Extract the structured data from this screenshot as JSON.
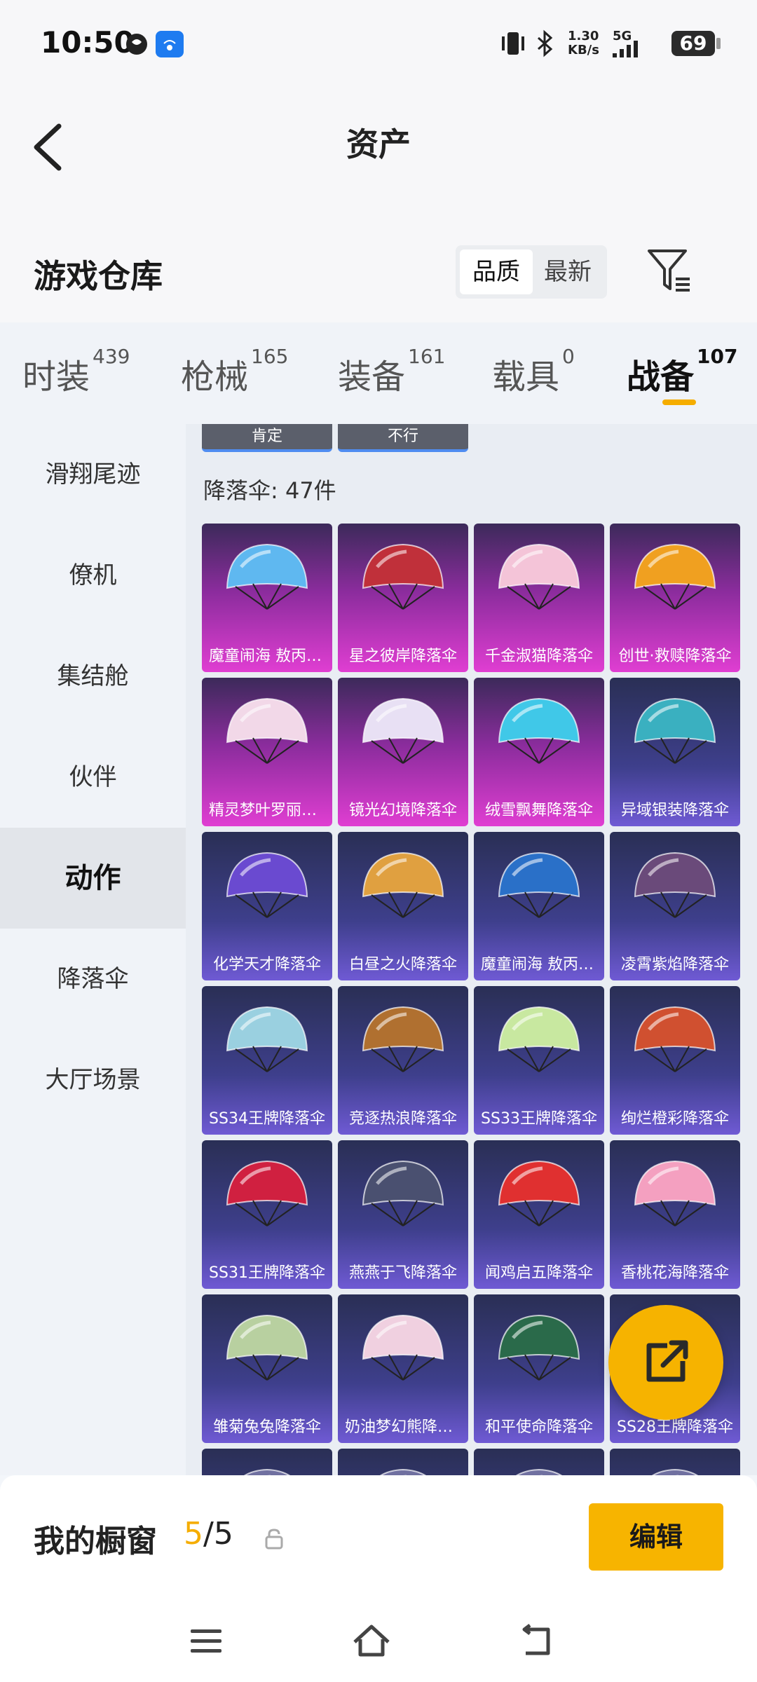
{
  "status_bar": {
    "time": "10:50",
    "net_speed_value": "1.30",
    "net_speed_unit": "KB/s",
    "network": "5G",
    "battery": "69"
  },
  "header": {
    "title": "资产"
  },
  "warehouse": {
    "title": "游戏仓库",
    "sort_options": [
      "品质",
      "最新"
    ],
    "active_sort": "品质"
  },
  "tabs": [
    {
      "label": "时装",
      "count": "439"
    },
    {
      "label": "枪械",
      "count": "165"
    },
    {
      "label": "装备",
      "count": "161"
    },
    {
      "label": "载具",
      "count": "0"
    },
    {
      "label": "战备",
      "count": "107"
    }
  ],
  "active_tab": "战备",
  "sidebar": {
    "items": [
      "滑翔尾迹",
      "僚机",
      "集结舱",
      "伙伴",
      "动作",
      "降落伞",
      "大厅场景"
    ],
    "active": "动作"
  },
  "chips": [
    "肯定",
    "不行"
  ],
  "section_count": "降落伞: 47件",
  "items": [
    {
      "name": "魔童闹海 敖丙降落伞",
      "rarity": "pink",
      "color": "#5fb8f0"
    },
    {
      "name": "星之彼岸降落伞",
      "rarity": "pink",
      "color": "#c0303a"
    },
    {
      "name": "千金淑猫降落伞",
      "rarity": "pink",
      "color": "#f4c4d8"
    },
    {
      "name": "创世·救赎降落伞",
      "rarity": "pink",
      "color": "#f0a020"
    },
    {
      "name": "精灵梦叶罗丽降落伞",
      "rarity": "pink",
      "color": "#f2d8e8"
    },
    {
      "name": "镜光幻境降落伞",
      "rarity": "pink",
      "color": "#e8e0f4"
    },
    {
      "name": "绒雪飘舞降落伞",
      "rarity": "pink",
      "color": "#40c8e8"
    },
    {
      "name": "异域银装降落伞",
      "rarity": "purple",
      "color": "#3ab0c0"
    },
    {
      "name": "化学天才降落伞",
      "rarity": "purple",
      "color": "#6a4ad0"
    },
    {
      "name": "白昼之火降落伞",
      "rarity": "purple",
      "color": "#e0a040"
    },
    {
      "name": "魔童闹海 敖丙降落伞",
      "rarity": "purple",
      "color": "#2a70c8"
    },
    {
      "name": "凌霄紫焰降落伞",
      "rarity": "purple",
      "color": "#6a4a7a"
    },
    {
      "name": "SS34王牌降落伞",
      "rarity": "purple",
      "color": "#9ad0e0"
    },
    {
      "name": "竞逐热浪降落伞",
      "rarity": "purple",
      "color": "#b07030"
    },
    {
      "name": "SS33王牌降落伞",
      "rarity": "purple",
      "color": "#c8e8a0"
    },
    {
      "name": "绚烂橙彩降落伞",
      "rarity": "purple",
      "color": "#d05030"
    },
    {
      "name": "SS31王牌降落伞",
      "rarity": "purple",
      "color": "#d02040"
    },
    {
      "name": "燕燕于飞降落伞",
      "rarity": "purple",
      "color": "#4a5070"
    },
    {
      "name": "闻鸡启五降落伞",
      "rarity": "purple",
      "color": "#e03030"
    },
    {
      "name": "香桃花海降落伞",
      "rarity": "purple",
      "color": "#f4a0c0"
    },
    {
      "name": "雏菊兔兔降落伞",
      "rarity": "purple",
      "color": "#b8d0a0"
    },
    {
      "name": "奶油梦幻熊降落伞",
      "rarity": "purple",
      "color": "#f0d0e0"
    },
    {
      "name": "和平使命降落伞",
      "rarity": "purple",
      "color": "#2a6a4a"
    },
    {
      "name": "SS28王牌降落伞",
      "rarity": "purple",
      "color": "#a0a0c0"
    },
    {
      "name": "",
      "rarity": "purple",
      "color": "#7070a0"
    },
    {
      "name": "",
      "rarity": "purple",
      "color": "#7070a0"
    },
    {
      "name": "",
      "rarity": "purple",
      "color": "#7070a0"
    },
    {
      "name": "",
      "rarity": "purple",
      "color": "#7070a0"
    }
  ],
  "showcase": {
    "title": "我的橱窗",
    "current": "5",
    "total": "/5",
    "edit_label": "编辑"
  },
  "colors": {
    "accent": "#f5ad00",
    "pink_card": "#e03ed2",
    "purple_card": "#6f5ad4"
  }
}
